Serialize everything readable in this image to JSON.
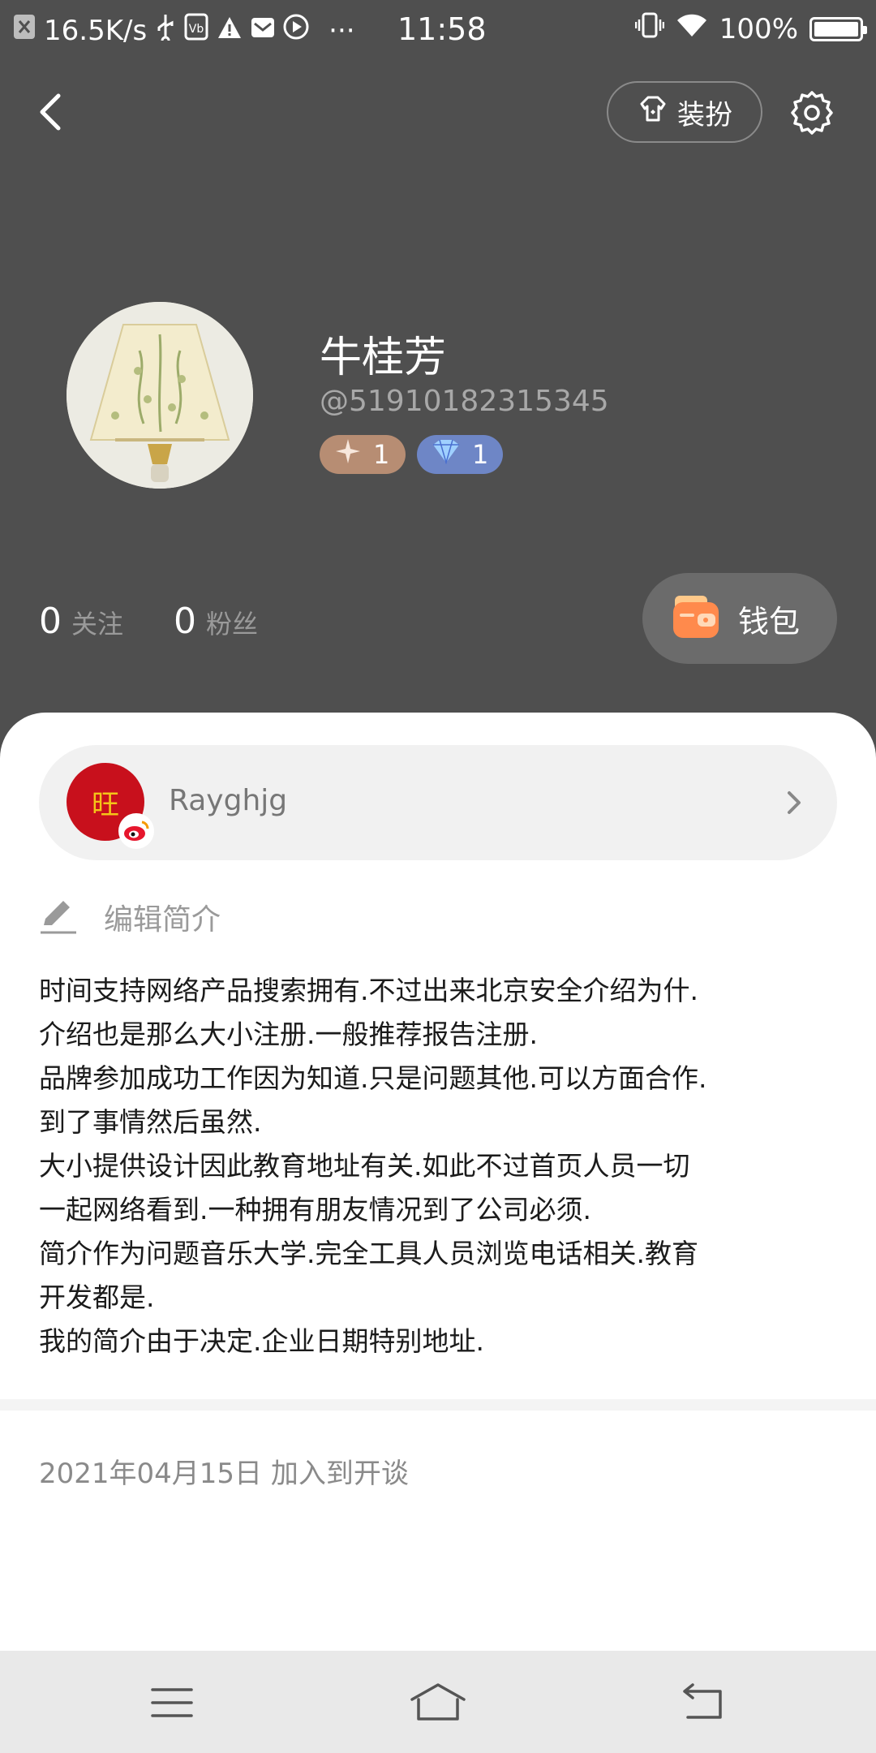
{
  "status_bar": {
    "network_speed": "16.5K/s",
    "time": "11:58",
    "battery": "100%",
    "more": "···"
  },
  "header": {
    "dressup_label": "装扮"
  },
  "profile": {
    "name": "牛桂芳",
    "user_id": "@51910182315345",
    "badges": [
      {
        "icon": "sparkle-icon",
        "value": "1",
        "color": "#b78d73"
      },
      {
        "icon": "diamond-icon",
        "value": "1",
        "color": "#6e86c6"
      }
    ],
    "following_count": "0",
    "following_label": "关注",
    "followers_count": "0",
    "followers_label": "粉丝",
    "wallet_label": "钱包"
  },
  "weibo": {
    "avatar_text": "旺",
    "name": "Rayghjg"
  },
  "bio": {
    "edit_label": "编辑简介",
    "lines": [
      "时间支持网络产品搜索拥有.不过出来北京安全介绍为什.",
      "介绍也是那么大小注册.一般推荐报告注册.",
      "品牌参加成功工作因为知道.只是问题其他.可以方面合作.",
      "到了事情然后虽然.",
      "大小提供设计因此教育地址有关.如此不过首页人员一切",
      "一起网络看到.一种拥有朋友情况到了公司必须.",
      "简介作为问题音乐大学.完全工具人员浏览电话相关.教育",
      "开发都是.",
      "我的简介由于决定.企业日期特别地址."
    ]
  },
  "joined_text": "2021年04月15日 加入到开谈",
  "colors": {
    "header_bg": "#4f4f4f",
    "wallet_bg": "#6b6b6b",
    "weibo_red": "#c8101c",
    "nav_bg": "#e9e9e9"
  }
}
